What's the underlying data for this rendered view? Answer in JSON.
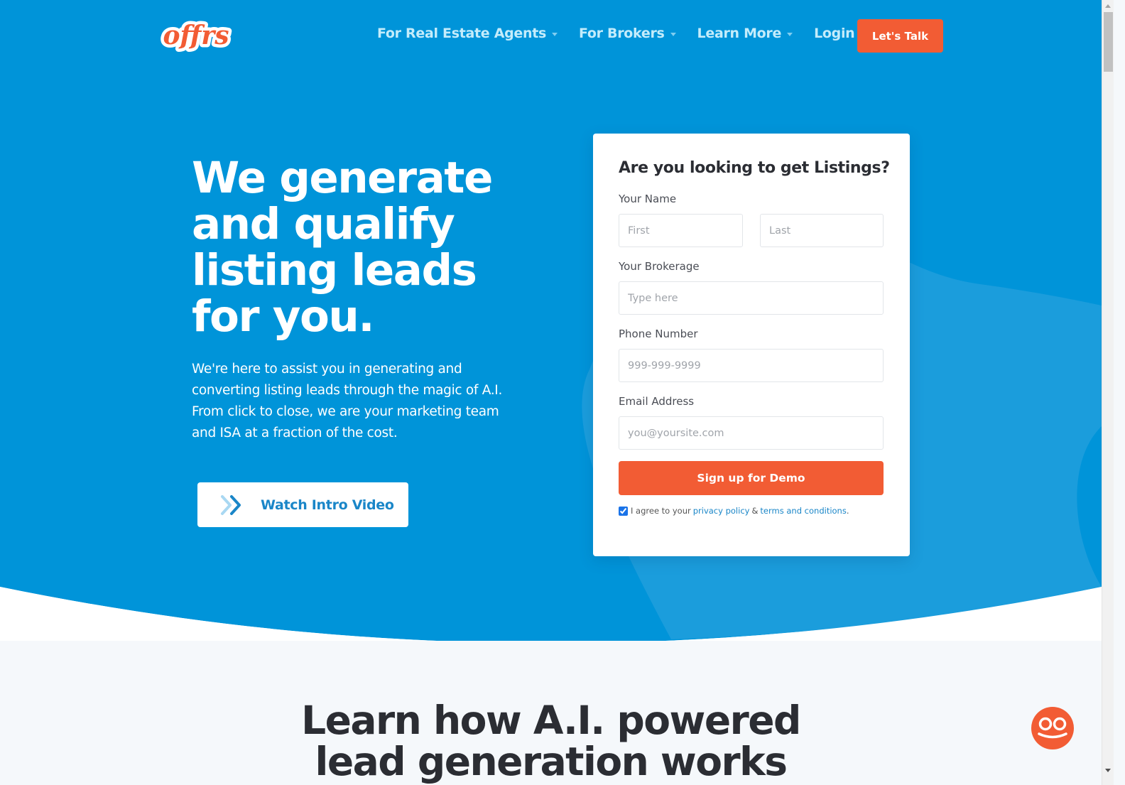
{
  "brand": {
    "logo_text": "offrs",
    "primary": "#0094d9",
    "accent": "#f25c34"
  },
  "nav": {
    "items": [
      {
        "label": "For Real Estate Agents",
        "icon": "caret-down-icon"
      },
      {
        "label": "For Brokers",
        "icon": "caret-down-icon"
      },
      {
        "label": "Learn More",
        "icon": "caret-down-icon"
      },
      {
        "label": "Login",
        "icon": "caret-down-icon"
      }
    ],
    "cta_label": "Let's Talk"
  },
  "hero": {
    "title_lines": [
      "We generate",
      "and qualify",
      "listing leads",
      "for you."
    ],
    "subtitle": "We're here to assist you in generating and converting listing leads through the magic of A.I. From click to close, we are your marketing team and ISA at a fraction of the cost.",
    "video_button": {
      "label": "Watch Intro Video",
      "icon": "double-chevron-right-icon"
    }
  },
  "form": {
    "title": "Are you looking to get Listings?",
    "name_label": "Your Name",
    "first_placeholder": "First",
    "first_value": "",
    "last_placeholder": "Last",
    "last_value": "",
    "brokerage_label": "Your Brokerage",
    "brokerage_placeholder": "Type here",
    "brokerage_value": "",
    "phone_label": "Phone Number",
    "phone_placeholder": "999-999-9999",
    "phone_value": "",
    "email_label": "Email Address",
    "email_placeholder": "you@yoursite.com",
    "email_value": "",
    "submit_label": "Sign up for Demo",
    "agree": {
      "checked": true,
      "prefix": "I agree to your",
      "privacy_link": "privacy policy",
      "amp": "&",
      "terms_link": "terms and conditions",
      "suffix": "."
    }
  },
  "lower": {
    "title_lines": [
      "Learn how A.I. powered",
      "lead generation works"
    ]
  },
  "chat": {
    "icon": "chat-smiley-icon"
  }
}
